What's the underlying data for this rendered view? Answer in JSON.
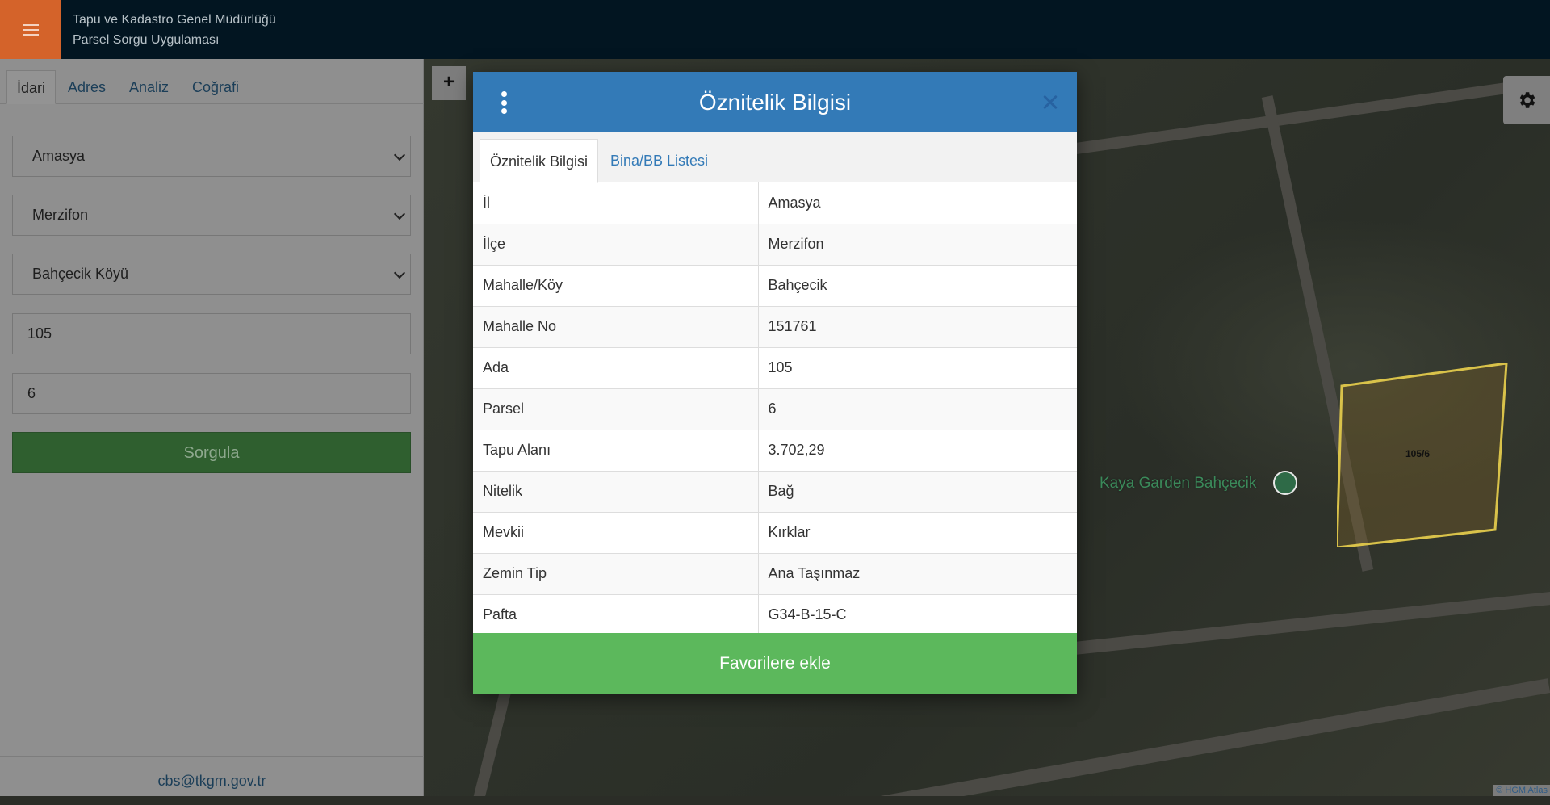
{
  "header": {
    "title_line1": "Tapu ve Kadastro Genel Müdürlüğü",
    "title_line2": "Parsel Sorgu Uygulaması"
  },
  "sidebar": {
    "tabs": [
      {
        "label": "İdari",
        "active": true
      },
      {
        "label": "Adres",
        "active": false
      },
      {
        "label": "Analiz",
        "active": false
      },
      {
        "label": "Coğrafi",
        "active": false
      }
    ],
    "province_select": "Amasya",
    "district_select": "Merzifon",
    "neighborhood_select": "Bahçecik Köyü",
    "block_input": "105",
    "parcel_input": "6",
    "query_button": "Sorgula",
    "footer_email": "cbs@tkgm.gov.tr"
  },
  "map": {
    "zoom_in_label": "+",
    "parcel_label": "105/6",
    "poi_label": "Kaya Garden Bahçecik",
    "attribution": "© HGM Atlas"
  },
  "modal": {
    "title": "Öznitelik Bilgisi",
    "tabs": [
      {
        "label": "Öznitelik Bilgisi",
        "active": true
      },
      {
        "label": "Bina/BB Listesi",
        "active": false
      }
    ],
    "rows": [
      {
        "key": "İl",
        "value": "Amasya"
      },
      {
        "key": "İlçe",
        "value": "Merzifon"
      },
      {
        "key": "Mahalle/Köy",
        "value": "Bahçecik"
      },
      {
        "key": "Mahalle No",
        "value": "151761"
      },
      {
        "key": "Ada",
        "value": "105"
      },
      {
        "key": "Parsel",
        "value": "6"
      },
      {
        "key": "Tapu Alanı",
        "value": "3.702,29"
      },
      {
        "key": "Nitelik",
        "value": "Bağ"
      },
      {
        "key": "Mevkii",
        "value": "Kırklar"
      },
      {
        "key": "Zemin Tip",
        "value": "Ana Taşınmaz"
      },
      {
        "key": "Pafta",
        "value": "G34-B-15-C"
      }
    ],
    "favorite_button": "Favorilere ekle"
  },
  "icons": {
    "menu": "hamburger-icon",
    "settings": "gear-icon",
    "modal_menu": "kebab-icon",
    "close": "close-icon",
    "poi": "poi-marker-icon"
  },
  "colors": {
    "header_bg": "#021521",
    "menu_accent": "#d4632a",
    "modal_header": "#337ab7",
    "favorite_button": "#5cb85c",
    "parcel_outline": "#d9c24a"
  }
}
